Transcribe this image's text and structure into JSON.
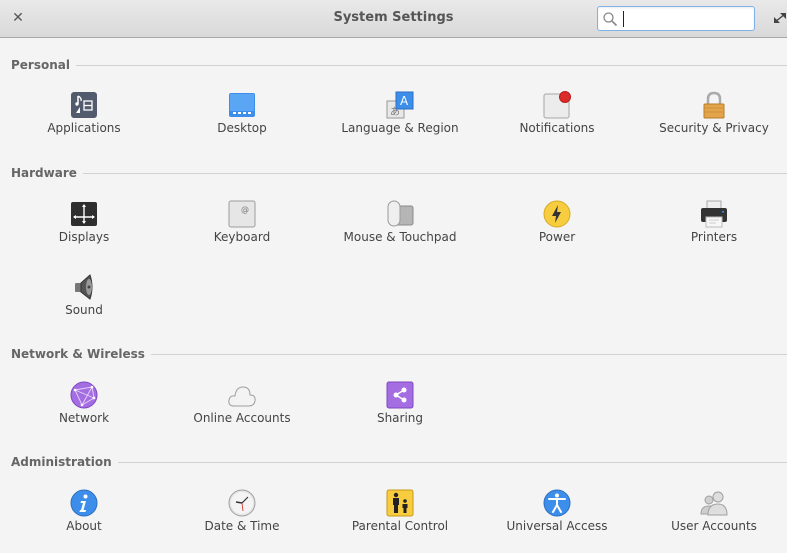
{
  "window": {
    "title": "System Settings",
    "close_icon": "close-icon",
    "maximize_icon": "maximize-icon"
  },
  "search": {
    "value": "",
    "placeholder": "",
    "icon": "search-icon"
  },
  "sections": [
    {
      "title": "Personal",
      "items": [
        {
          "label": "Applications",
          "icon": "applications-icon"
        },
        {
          "label": "Desktop",
          "icon": "desktop-icon"
        },
        {
          "label": "Language & Region",
          "icon": "language-icon"
        },
        {
          "label": "Notifications",
          "icon": "notifications-icon"
        },
        {
          "label": "Security & Privacy",
          "icon": "padlock-icon"
        }
      ]
    },
    {
      "title": "Hardware",
      "items": [
        {
          "label": "Displays",
          "icon": "displays-icon"
        },
        {
          "label": "Keyboard",
          "icon": "keyboard-icon"
        },
        {
          "label": "Mouse & Touchpad",
          "icon": "mouse-icon"
        },
        {
          "label": "Power",
          "icon": "power-icon"
        },
        {
          "label": "Printers",
          "icon": "printer-icon"
        },
        {
          "label": "Sound",
          "icon": "speaker-icon"
        }
      ]
    },
    {
      "title": "Network & Wireless",
      "items": [
        {
          "label": "Network",
          "icon": "network-icon"
        },
        {
          "label": "Online Accounts",
          "icon": "cloud-icon"
        },
        {
          "label": "Sharing",
          "icon": "share-icon"
        }
      ]
    },
    {
      "title": "Administration",
      "items": [
        {
          "label": "About",
          "icon": "info-icon"
        },
        {
          "label": "Date & Time",
          "icon": "clock-icon"
        },
        {
          "label": "Parental Control",
          "icon": "parental-icon"
        },
        {
          "label": "Universal Access",
          "icon": "accessibility-icon"
        },
        {
          "label": "User Accounts",
          "icon": "users-icon"
        }
      ]
    }
  ]
}
